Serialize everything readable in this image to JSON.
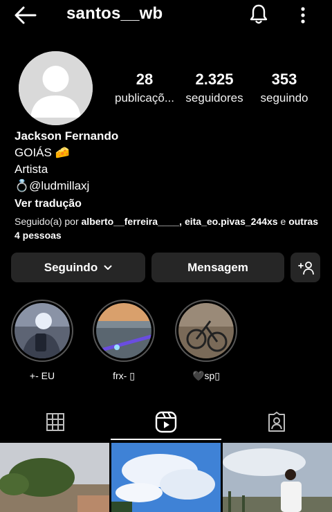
{
  "header": {
    "username": "santos__wb",
    "back_icon": "arrow-left-icon",
    "notifications_icon": "bell-icon",
    "menu_icon": "more-vertical-icon"
  },
  "stats": [
    {
      "value": "28",
      "label": "publicaçõ..."
    },
    {
      "value": "2.325",
      "label": "seguidores"
    },
    {
      "value": "353",
      "label": "seguindo"
    }
  ],
  "bio": {
    "name": "Jackson Fernando",
    "lines": [
      "GOIÁS 🧀",
      "Artista",
      "💍@ludmillaxj"
    ],
    "translate": "Ver tradução",
    "followed_prefix": "Seguido(a) por ",
    "followed_users": "alberto__ferreira____, eita_eo.pivas_244xs",
    "followed_mid": " e ",
    "followed_others": "outras 4 pessoas"
  },
  "actions": {
    "following_label": "Seguindo",
    "message_label": "Mensagem",
    "add_user_icon": "person-add-icon"
  },
  "highlights": [
    {
      "label": "+- EU"
    },
    {
      "label": "frx- ▯"
    },
    {
      "label": "🖤sp▯"
    }
  ],
  "tabs": [
    {
      "icon": "grid-icon"
    },
    {
      "icon": "reels-icon"
    },
    {
      "icon": "tagged-icon"
    }
  ],
  "colors": {
    "background": "#000000",
    "button": "#262626",
    "text": "#ffffff"
  }
}
